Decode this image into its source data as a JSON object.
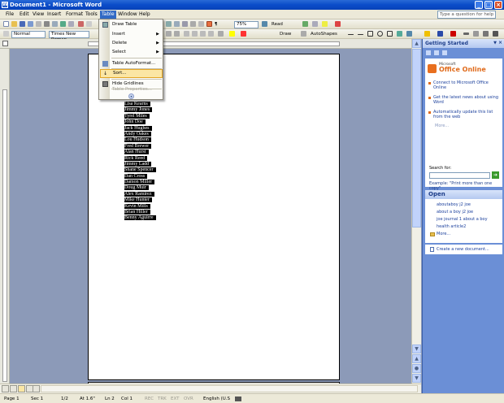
{
  "window": {
    "title": "Document1 - Microsoft Word"
  },
  "menubar": {
    "items": [
      "File",
      "Edit",
      "View",
      "Insert",
      "Format",
      "Tools",
      "Table",
      "Window",
      "Help"
    ],
    "help_placeholder": "Type a question for help"
  },
  "toolbar": {
    "style": "Normal",
    "font": "Times New Roman",
    "zoom": "75%",
    "read_label": "Read",
    "draw_label": "Draw",
    "autoshapes_label": "AutoShapes"
  },
  "table_menu": {
    "items": [
      {
        "label": "Draw Table",
        "icon": "draw-table-icon"
      },
      {
        "label": "Insert",
        "submenu": true
      },
      {
        "label": "Delete",
        "submenu": true
      },
      {
        "label": "Select",
        "submenu": true
      },
      {
        "label": "Table AutoFormat...",
        "icon": "autoformat-icon"
      },
      {
        "label": "Sort...",
        "icon": "sort-icon",
        "highlighted": true
      },
      {
        "label": "Hide Gridlines",
        "icon": "gridlines-icon"
      },
      {
        "label": "Table Properties...",
        "disabled": true
      }
    ]
  },
  "document": {
    "names": [
      "Lisa Kearns",
      "Jimmy Jones",
      "Tyrel Miles",
      "John Doe",
      "Jack Hughes",
      "Andy Oakes",
      "Lou Hudson",
      "Fred Brewer",
      "Alan Hurst",
      "Rick Reed",
      "Jimmy Ladd",
      "Shane Spencer",
      "Dan Cross",
      "Damon Miller",
      "Doug Muir",
      "Alex Ramirez",
      "Mike Hunter",
      "Kevin Mills",
      "Brian Hiller",
      "Benny Aguirre"
    ]
  },
  "taskpane": {
    "title": "Getting Started",
    "logo_small": "Microsoft",
    "logo_main": "Office Online",
    "links": [
      "Connect to Microsoft Office Online",
      "Get the latest news about using Word",
      "Automatically update this list from the web"
    ],
    "more": "More...",
    "search_label": "Search for:",
    "example": "Example: \"Print more than one copy\"",
    "open_title": "Open",
    "recent_files": [
      "aboutaboy j2 joe",
      "about a boy j2 joe",
      "joe journal 1 about a boy",
      "health article2"
    ],
    "open_more": "More...",
    "new_doc": "Create a new document..."
  },
  "status": {
    "page": "Page 1",
    "sec": "Sec 1",
    "pages": "1/2",
    "at": "At 1.6\"",
    "ln": "Ln 2",
    "col": "Col 1",
    "rec": "REC",
    "trk": "TRK",
    "ext": "EXT",
    "ovr": "OVR",
    "lang": "English (U.S"
  },
  "colors": {
    "titlebar": "#0a4cc9",
    "menu_highlight": "#316ac5",
    "item_highlight": "#fbe6a4"
  }
}
